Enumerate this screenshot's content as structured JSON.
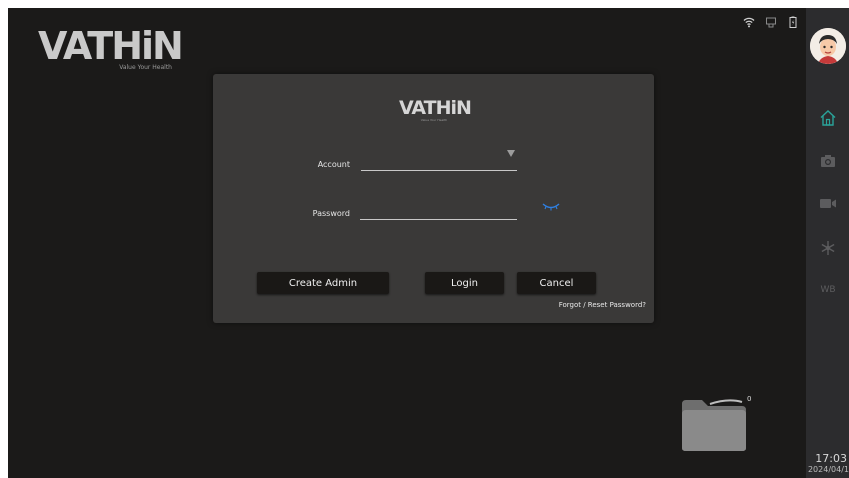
{
  "brand": {
    "name": "VATHiN",
    "tagline": "Value Your Health"
  },
  "status_icons": [
    "wifi-icon",
    "storage-icon",
    "battery-icon"
  ],
  "sidebar": {
    "items": [
      {
        "name": "home",
        "icon": "home-icon",
        "active": true
      },
      {
        "name": "camera",
        "icon": "camera-icon",
        "active": false
      },
      {
        "name": "video",
        "icon": "video-camera-icon",
        "active": false
      },
      {
        "name": "settings",
        "icon": "snowflake-icon",
        "active": false
      },
      {
        "name": "white-balance",
        "label": "WB",
        "active": false
      }
    ],
    "clock_time": "17:03",
    "clock_date": "2024/04/1"
  },
  "login": {
    "logo_text": "VATHiN",
    "logo_tagline": "Value Your Health",
    "account_label": "Account",
    "account_value": "",
    "password_label": "Password",
    "password_value": "",
    "create_admin_label": "Create Admin",
    "login_label": "Login",
    "cancel_label": "Cancel",
    "forgot_label": "Forgot / Reset Password?"
  },
  "folder": {
    "count": "0"
  },
  "colors": {
    "background": "#1b1a19",
    "dialog": "#3a3938",
    "sidebar": "#2c2c2e",
    "accent_home": "#2aa39a",
    "eye_icon": "#2f7fe0",
    "button": "#1a1816"
  }
}
